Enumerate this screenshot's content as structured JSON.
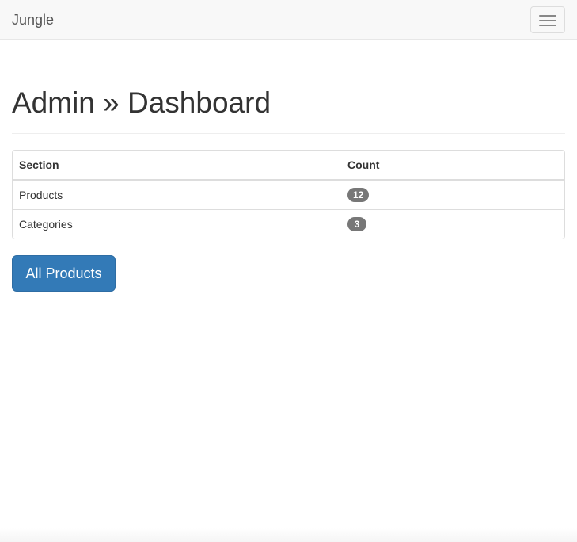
{
  "navbar": {
    "brand": "Jungle",
    "toggle_icon": "hamburger-menu-icon"
  },
  "page": {
    "title": "Admin » Dashboard"
  },
  "table": {
    "headers": [
      "Section",
      "Count"
    ],
    "rows": [
      {
        "section": "Products",
        "count": "12"
      },
      {
        "section": "Categories",
        "count": "3"
      }
    ]
  },
  "actions": {
    "all_products_label": "All Products"
  },
  "colors": {
    "navbar_bg": "#f8f8f8",
    "primary": "#337ab7",
    "badge": "#777777"
  }
}
